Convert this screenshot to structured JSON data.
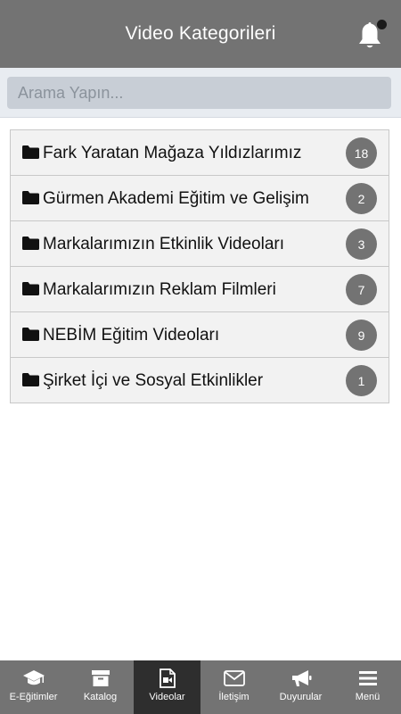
{
  "header": {
    "title": "Video Kategorileri"
  },
  "search": {
    "placeholder": "Arama Yapın..."
  },
  "categories": [
    {
      "label": "Fark Yaratan Mağaza Yıldızlarımız",
      "count": "18"
    },
    {
      "label": "Gürmen Akademi Eğitim ve Gelişim",
      "count": "2"
    },
    {
      "label": "Markalarımızın Etkinlik Videoları",
      "count": "3"
    },
    {
      "label": "Markalarımızın Reklam Filmleri",
      "count": "7"
    },
    {
      "label": "NEBİM Eğitim Videoları",
      "count": "9"
    },
    {
      "label": "Şirket İçi ve Sosyal Etkinlikler",
      "count": "1"
    }
  ],
  "nav": [
    {
      "label": "E-Eğitimler",
      "icon": "graduation-cap-icon"
    },
    {
      "label": "Katalog",
      "icon": "archive-box-icon"
    },
    {
      "label": "Videolar",
      "icon": "video-file-icon",
      "active": true
    },
    {
      "label": "İletişim",
      "icon": "envelope-icon"
    },
    {
      "label": "Duyurular",
      "icon": "megaphone-icon"
    },
    {
      "label": "Menü",
      "icon": "hamburger-menu-icon"
    }
  ],
  "colors": {
    "header_bg": "#737373",
    "search_bg": "#e8ecf1",
    "badge_bg": "#737373",
    "nav_active_bg": "#2e2e2e"
  }
}
